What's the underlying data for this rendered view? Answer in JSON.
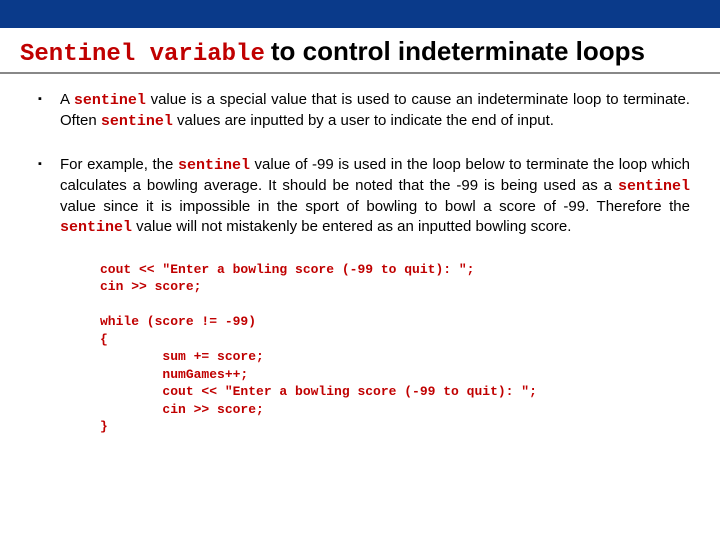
{
  "title": {
    "code": "Sentinel variable",
    "rest": "to control indeterminate loops"
  },
  "bullets": [
    {
      "parts": [
        {
          "t": "A "
        },
        {
          "t": "sentinel",
          "kw": true
        },
        {
          "t": " value is a special value that is used to cause an indeterminate loop to terminate. Often "
        },
        {
          "t": "sentinel",
          "kw": true
        },
        {
          "t": " values are inputted by a user to indicate the end of input."
        }
      ]
    },
    {
      "parts": [
        {
          "t": "For example, the "
        },
        {
          "t": "sentinel",
          "kw": true
        },
        {
          "t": " value of -99 is used in the loop below to terminate the loop which calculates a bowling average. It should be noted that the -99 is being used as a "
        },
        {
          "t": "sentinel",
          "kw": true
        },
        {
          "t": " value since it is impossible in the sport of bowling to bowl a score of -99. Therefore the "
        },
        {
          "t": "sentinel",
          "kw": true
        },
        {
          "t": " value will not mistakenly be entered as an inputted bowling score."
        }
      ]
    }
  ],
  "code": "cout << \"Enter a bowling score (-99 to quit): \";\ncin >> score;\n\nwhile (score != -99)\n{\n        sum += score;\n        numGames++;\n        cout << \"Enter a bowling score (-99 to quit): \";\n        cin >> score;\n}"
}
